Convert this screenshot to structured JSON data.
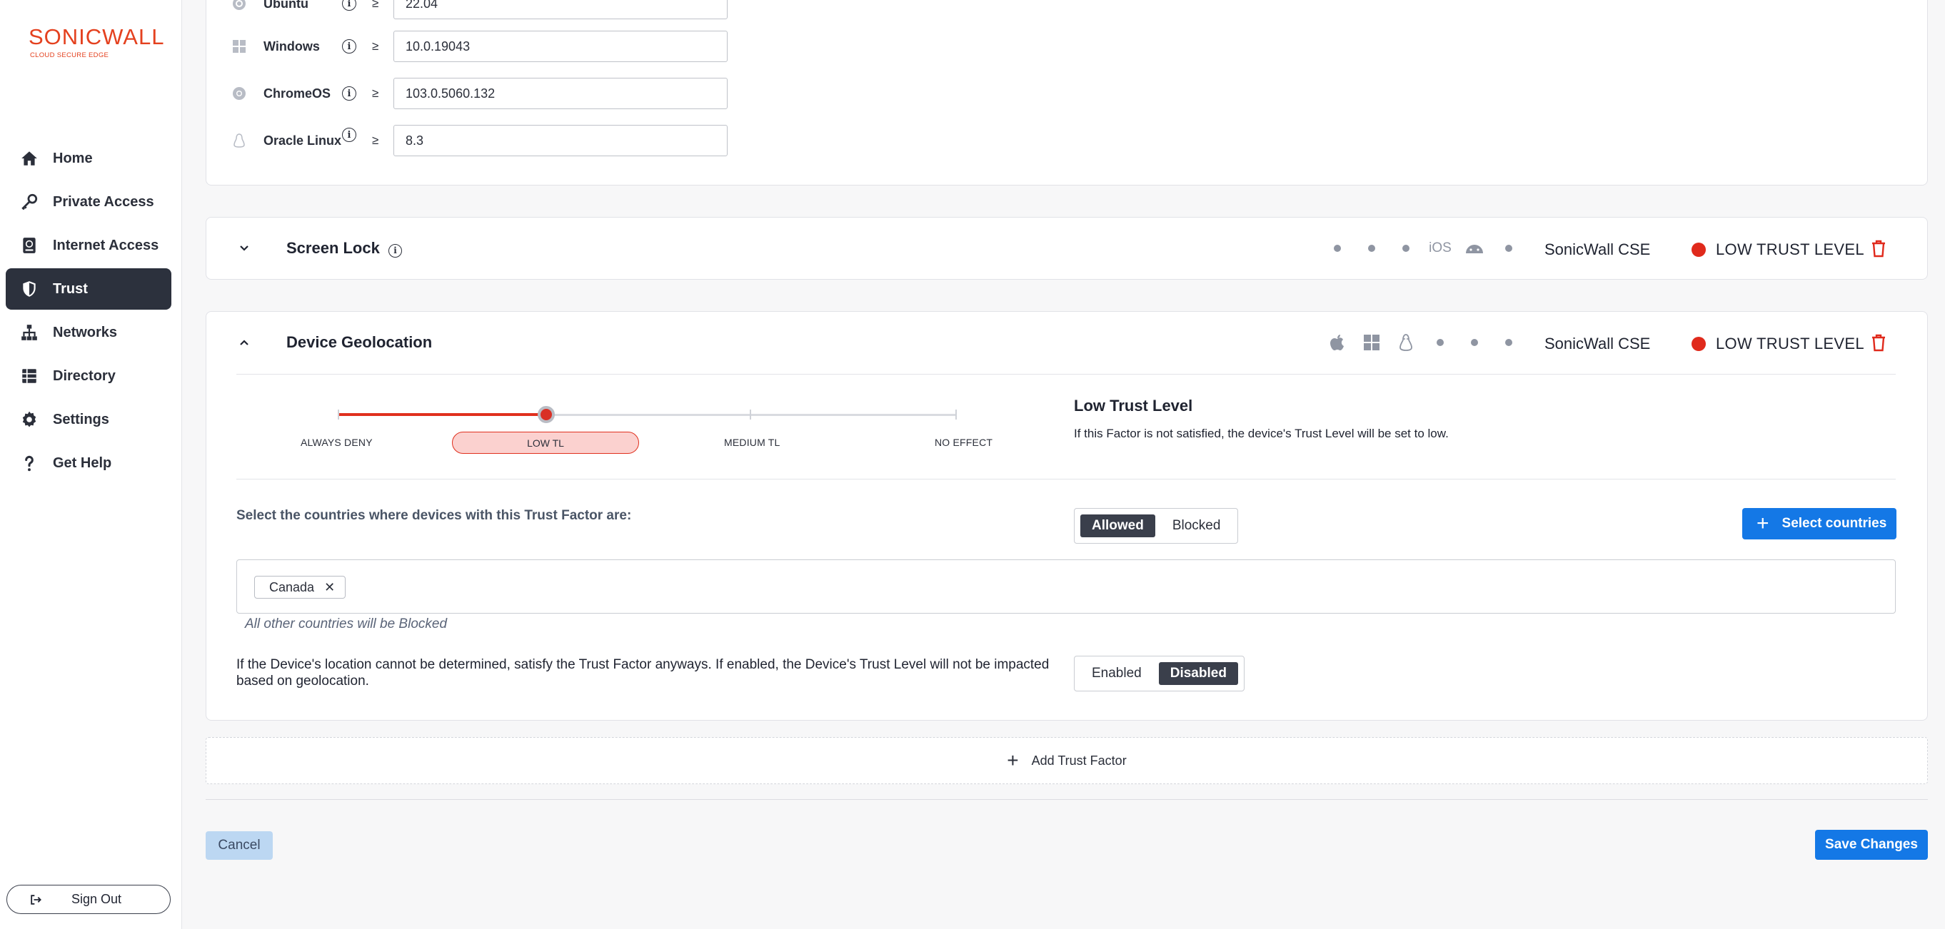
{
  "brand": {
    "name": "SONICWALL",
    "tagline": "CLOUD SECURE EDGE"
  },
  "sidebar": {
    "items": [
      {
        "label": "Home",
        "icon": "home-icon"
      },
      {
        "label": "Private Access",
        "icon": "key-icon"
      },
      {
        "label": "Internet Access",
        "icon": "globe-book-icon"
      },
      {
        "label": "Trust",
        "icon": "shield-icon",
        "active": true
      },
      {
        "label": "Networks",
        "icon": "network-icon"
      },
      {
        "label": "Directory",
        "icon": "list-icon"
      },
      {
        "label": "Settings",
        "icon": "gear-icon"
      },
      {
        "label": "Get Help",
        "icon": "question-icon"
      }
    ],
    "sign_out": "Sign Out"
  },
  "os_versions": [
    {
      "name": "Ubuntu",
      "op": "≥",
      "value": "22.04",
      "icon": "ubuntu-icon"
    },
    {
      "name": "Windows",
      "op": "≥",
      "value": "10.0.19043",
      "icon": "windows-icon"
    },
    {
      "name": "ChromeOS",
      "op": "≥",
      "value": "103.0.5060.132",
      "icon": "chrome-icon"
    },
    {
      "name": "Oracle Linux",
      "op": "≥",
      "value": "8.3",
      "icon": "linux-icon"
    }
  ],
  "screen_lock": {
    "title": "Screen Lock",
    "ios_label": "iOS",
    "source": "SonicWall CSE",
    "trust_level": "LOW TRUST LEVEL"
  },
  "geolocation": {
    "title": "Device Geolocation",
    "source": "SonicWall CSE",
    "trust_level": "LOW TRUST LEVEL",
    "slider": {
      "labels": [
        "ALWAYS DENY",
        "LOW TL",
        "MEDIUM TL",
        "NO EFFECT"
      ],
      "selected": "LOW TL"
    },
    "level_title": "Low Trust Level",
    "level_desc": "If this Factor is not satisfied, the device's Trust Level will be set to low.",
    "select_label": "Select the countries where devices with this Trust Factor are:",
    "mode": {
      "allowed": "Allowed",
      "blocked": "Blocked",
      "selected": "Allowed"
    },
    "select_countries": "Select countries",
    "countries": [
      "Canada"
    ],
    "other_note": "All other countries will be Blocked",
    "unknown_note": "If the Device's location cannot be determined, satisfy the Trust Factor anyways. If enabled, the Device's Trust Level will not be impacted based on geolocation.",
    "unknown_toggle": {
      "enabled": "Enabled",
      "disabled": "Disabled",
      "selected": "Disabled"
    }
  },
  "add_trust_factor": "Add Trust Factor",
  "actions": {
    "cancel": "Cancel",
    "save": "Save Changes"
  },
  "colors": {
    "accent": "#1478e6",
    "danger": "#e02a1c",
    "brand": "#e4411f",
    "nav_active": "#2c313d"
  }
}
